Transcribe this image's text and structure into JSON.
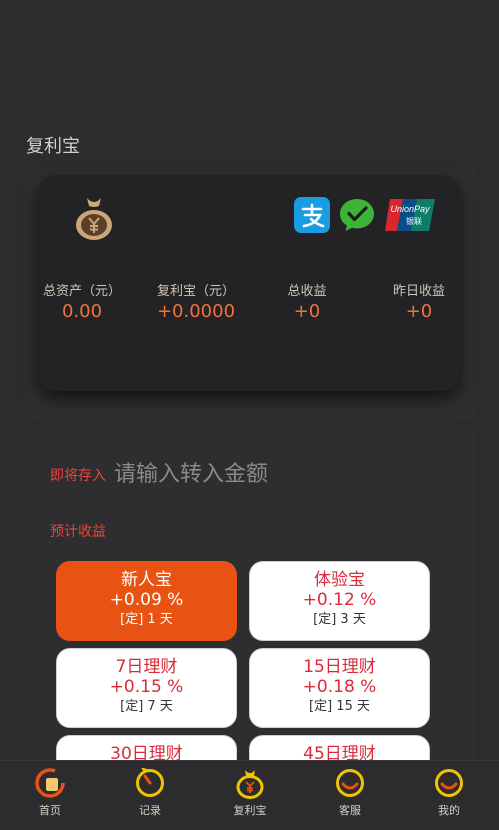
{
  "page": {
    "title": "复利宝"
  },
  "colors": {
    "accent": "#e85314",
    "value": "#f0713a",
    "red": "#d92b3a",
    "gold": "#f2c400"
  },
  "account": {
    "stats": [
      {
        "label": "总资产（元）",
        "value": "0.00"
      },
      {
        "label": "复利宝（元）",
        "value": "+0.0000"
      },
      {
        "label": "总收益",
        "value": "+0"
      },
      {
        "label": "昨日收益",
        "value": "+0"
      }
    ],
    "icons": {
      "fund": "moneybag-icon",
      "payments": [
        "alipay-icon",
        "wechat-pay-icon",
        "unionpay-icon"
      ]
    }
  },
  "deposit": {
    "label": "即将存入",
    "placeholder": "请输入转入金额"
  },
  "earnings": {
    "label": "预计收益"
  },
  "products": [
    {
      "name": "新人宝",
      "rate": "+0.09 %",
      "term": "[定] 1 天",
      "selected": true
    },
    {
      "name": "体验宝",
      "rate": "+0.12 %",
      "term": "[定] 3 天",
      "selected": false
    },
    {
      "name": "7日理财",
      "rate": "+0.15 %",
      "term": "[定] 7 天",
      "selected": false
    },
    {
      "name": "15日理财",
      "rate": "+0.18 %",
      "term": "[定] 15 天",
      "selected": false
    },
    {
      "name": "30日理财",
      "rate": "",
      "term": "",
      "selected": false
    },
    {
      "name": "45日理财",
      "rate": "",
      "term": "",
      "selected": false
    }
  ],
  "tabbar": {
    "items": [
      {
        "label": "首页",
        "icon": "home-icon"
      },
      {
        "label": "记录",
        "icon": "records-icon"
      },
      {
        "label": "复利宝",
        "icon": "fund-icon"
      },
      {
        "label": "客服",
        "icon": "support-icon"
      },
      {
        "label": "我的",
        "icon": "profile-icon"
      }
    ]
  }
}
